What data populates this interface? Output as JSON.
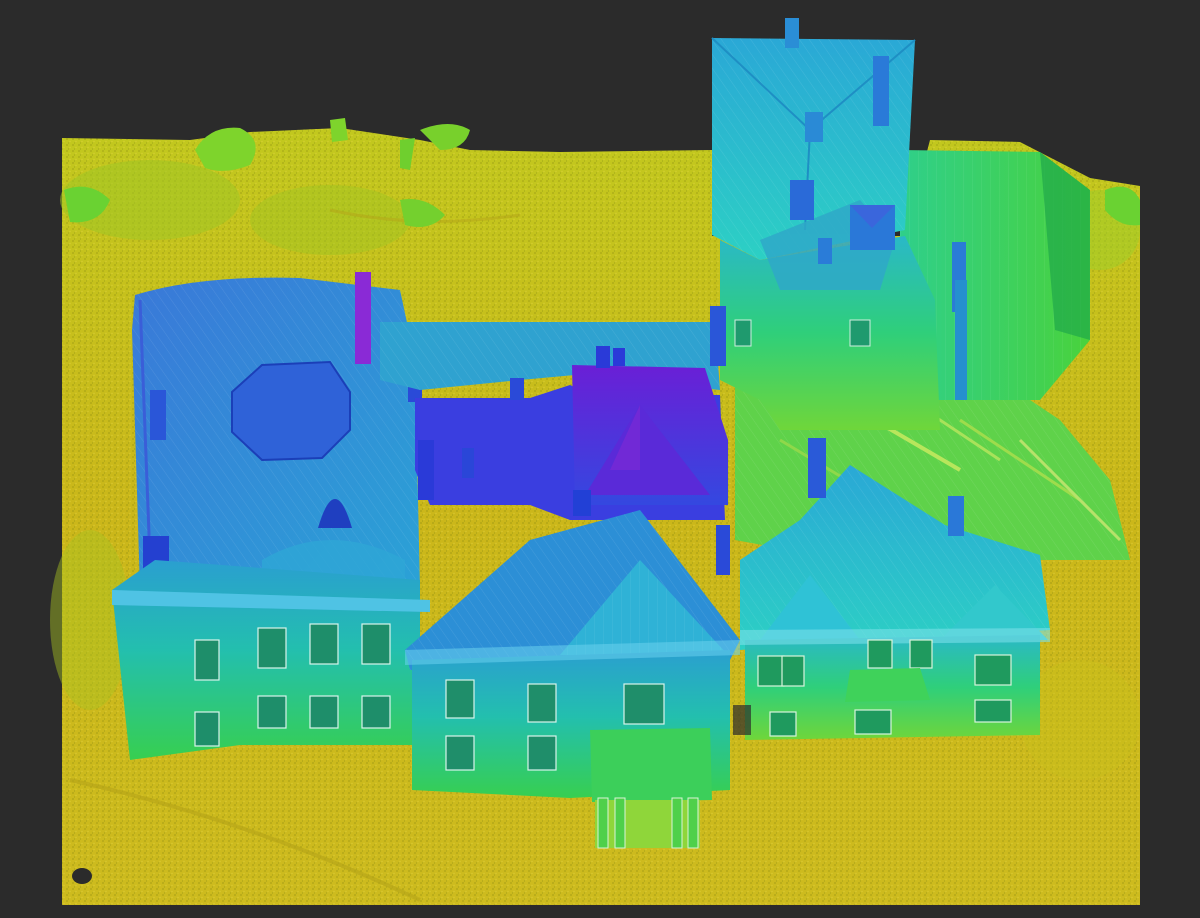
{
  "viewport": {
    "background": "#2b2b2b",
    "content": "point-cloud-elevation-render",
    "colormap": [
      "#d9c200",
      "#9fd22a",
      "#2fcf6a",
      "#1fc6c2",
      "#2a8bd8",
      "#3a3fe0",
      "#8a1fd8"
    ]
  }
}
